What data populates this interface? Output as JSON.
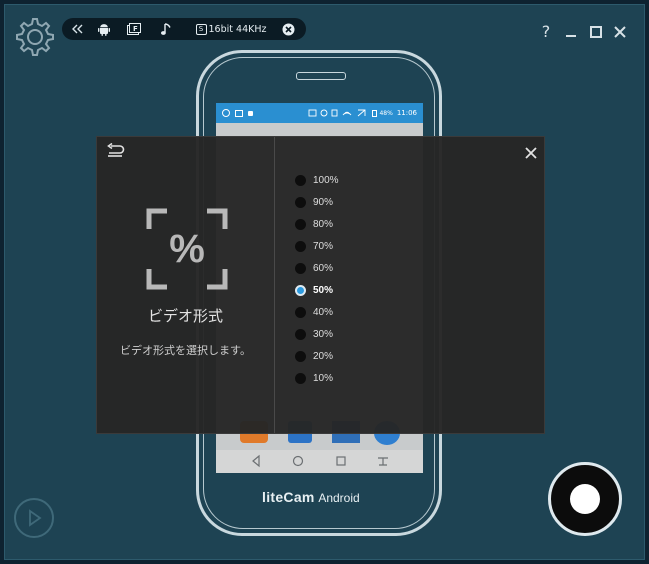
{
  "colors": {
    "background": "#1e4353",
    "toolbar": "#0b1b24",
    "dialog": "#262626",
    "accent": "#2d9be0",
    "screen_statusbar": "#2a8fd1"
  },
  "toolbar": {
    "icons": [
      "settings-gear-icon",
      "collapse-icon",
      "android-icon",
      "screen-f-icon",
      "music-note-icon",
      "audio-badge-icon",
      "close-circle-icon"
    ],
    "audio_label": "16bit 44KHz",
    "audio_badge": "S"
  },
  "window": {
    "help": "?"
  },
  "phone": {
    "status_time": "11:06",
    "status_battery": "48%",
    "brand_part1": "liteCam",
    "brand_part2": "Android"
  },
  "dialog": {
    "title": "ビデオ形式",
    "description": "ビデオ形式を選択します。",
    "options": [
      "100%",
      "90%",
      "80%",
      "70%",
      "60%",
      "50%",
      "40%",
      "30%",
      "20%",
      "10%"
    ],
    "selected": "50%"
  }
}
